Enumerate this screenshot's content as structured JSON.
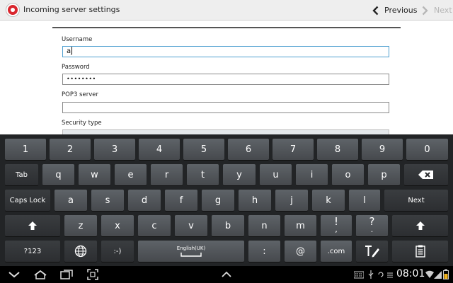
{
  "header": {
    "title": "Incoming server settings",
    "previous_label": "Previous",
    "next_label": "Next"
  },
  "form": {
    "username": {
      "label": "Username",
      "value": "aj"
    },
    "password": {
      "label": "Password",
      "value": "••••••••"
    },
    "pop3": {
      "label": "POP3 server",
      "value": ""
    },
    "security": {
      "label": "Security type"
    }
  },
  "keyboard": {
    "row1": [
      "1",
      "2",
      "3",
      "4",
      "5",
      "6",
      "7",
      "8",
      "9",
      "0"
    ],
    "row2_tab": "Tab",
    "row2": [
      "q",
      "w",
      "e",
      "r",
      "t",
      "y",
      "u",
      "i",
      "o",
      "p"
    ],
    "row3_caps": "Caps Lock",
    "row3": [
      "a",
      "s",
      "d",
      "f",
      "g",
      "h",
      "j",
      "k",
      "l"
    ],
    "row3_next": "Next",
    "row4": [
      "z",
      "x",
      "c",
      "v",
      "b",
      "n",
      "m",
      "!",
      "?"
    ],
    "row4_sub": [
      ",",
      "."
    ],
    "row5_mode": "?123",
    "row5_smiley": ":-)",
    "row5_space_lang": "English(UK)",
    "row5_colon": ":",
    "row5_at": "@",
    "row5_com": ".com"
  },
  "status_bar": {
    "time": "08:01"
  },
  "icons": [
    "back-icon",
    "home-icon",
    "recent-apps-icon",
    "screenshot-icon",
    "chevron-up-icon",
    "shift-icon",
    "backspace-icon",
    "globe-icon",
    "handwriting-icon",
    "clipboard-icon",
    "keyboard-icon",
    "usb-icon",
    "wifi-icon",
    "signal-icon",
    "battery-icon"
  ],
  "colors": {
    "accent": "#4f9fd0",
    "app_red": "#d9262e"
  }
}
